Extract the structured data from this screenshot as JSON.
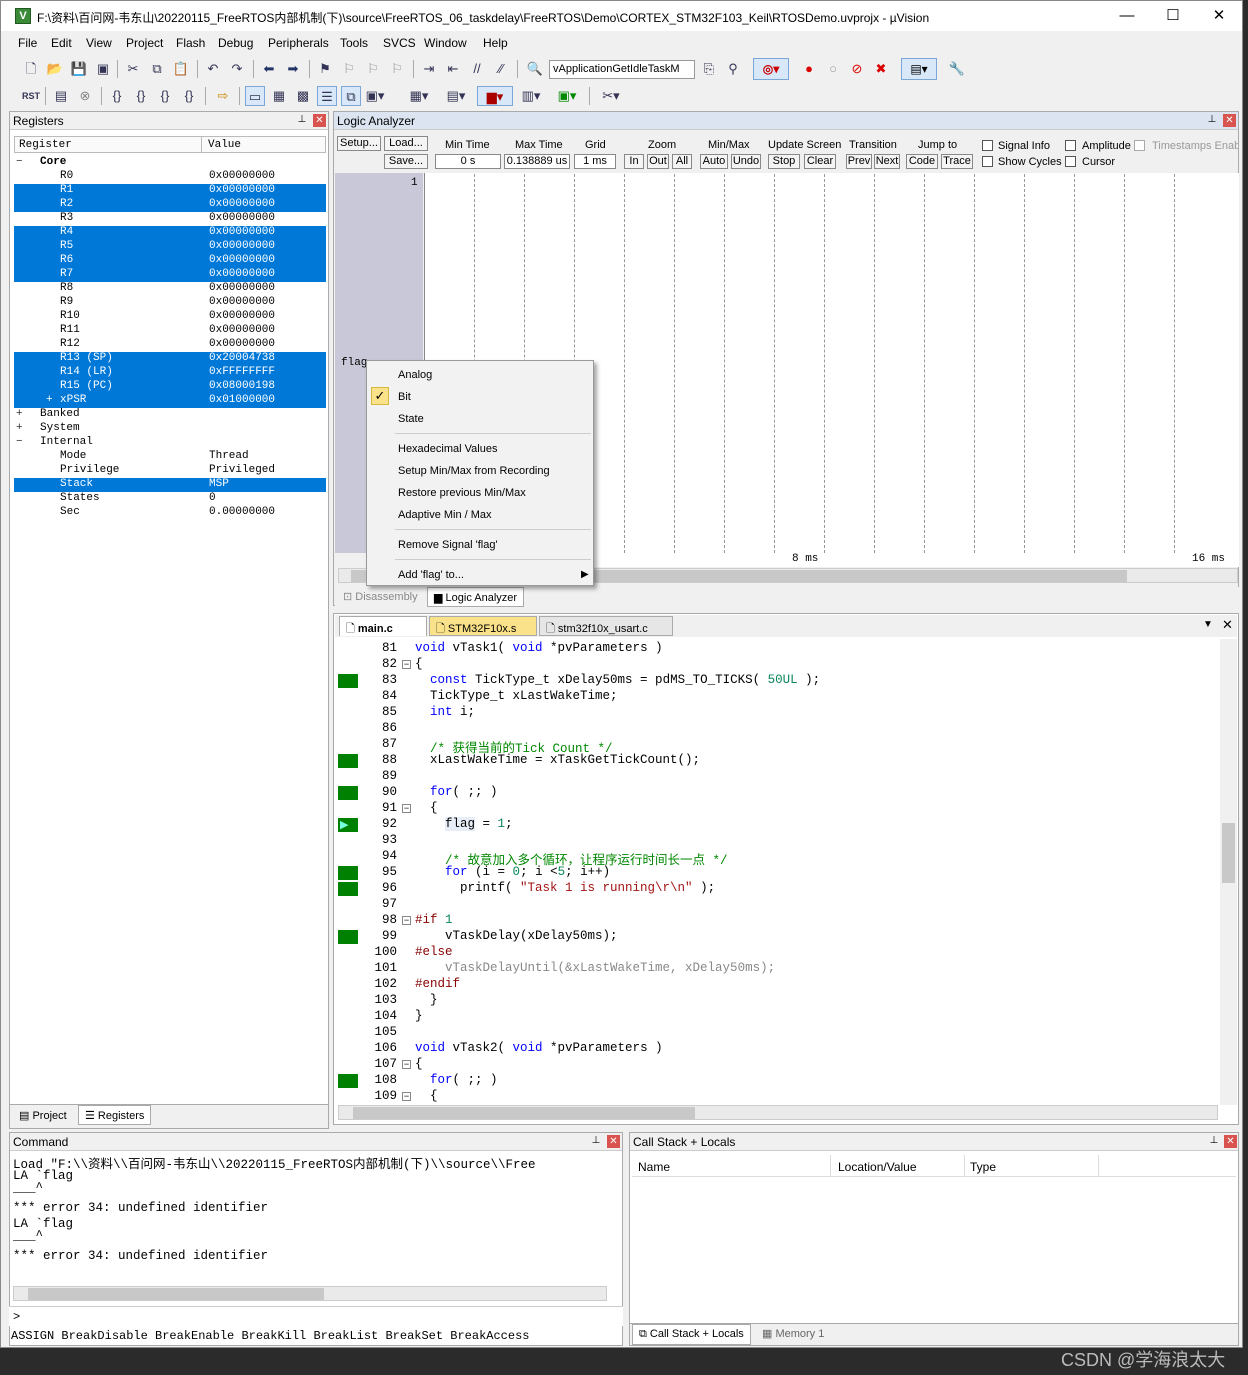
{
  "window": {
    "title": "F:\\资料\\百问网-韦东山\\20220115_FreeRTOS内部机制(下)\\source\\FreeRTOS_06_taskdelay\\FreeRTOS\\Demo\\CORTEX_STM32F103_Keil\\RTOSDemo.uvprojx - µVision",
    "minimize": "—",
    "maximize": "☐",
    "close": "✕"
  },
  "menu": [
    "File",
    "Edit",
    "View",
    "Project",
    "Flash",
    "Debug",
    "Peripherals",
    "Tools",
    "SVCS",
    "Window",
    "Help"
  ],
  "toolbar": {
    "function_combo": "vApplicationGetIdleTaskM"
  },
  "registers": {
    "title": "Registers",
    "col_register": "Register",
    "col_value": "Value",
    "rows": [
      {
        "name": "Core",
        "value": "",
        "level": 0,
        "expander": "−",
        "selected": false,
        "bold": true
      },
      {
        "name": "R0",
        "value": "0x00000000",
        "level": 2,
        "expander": "",
        "selected": false
      },
      {
        "name": "R1",
        "value": "0x00000000",
        "level": 2,
        "expander": "",
        "selected": true
      },
      {
        "name": "R2",
        "value": "0x00000000",
        "level": 2,
        "expander": "",
        "selected": true
      },
      {
        "name": "R3",
        "value": "0x00000000",
        "level": 2,
        "expander": "",
        "selected": false
      },
      {
        "name": "R4",
        "value": "0x00000000",
        "level": 2,
        "expander": "",
        "selected": true
      },
      {
        "name": "R5",
        "value": "0x00000000",
        "level": 2,
        "expander": "",
        "selected": true
      },
      {
        "name": "R6",
        "value": "0x00000000",
        "level": 2,
        "expander": "",
        "selected": true
      },
      {
        "name": "R7",
        "value": "0x00000000",
        "level": 2,
        "expander": "",
        "selected": true
      },
      {
        "name": "R8",
        "value": "0x00000000",
        "level": 2,
        "expander": "",
        "selected": false
      },
      {
        "name": "R9",
        "value": "0x00000000",
        "level": 2,
        "expander": "",
        "selected": false
      },
      {
        "name": "R10",
        "value": "0x00000000",
        "level": 2,
        "expander": "",
        "selected": false
      },
      {
        "name": "R11",
        "value": "0x00000000",
        "level": 2,
        "expander": "",
        "selected": false
      },
      {
        "name": "R12",
        "value": "0x00000000",
        "level": 2,
        "expander": "",
        "selected": false
      },
      {
        "name": "R13 (SP)",
        "value": "0x20004738",
        "level": 2,
        "expander": "",
        "selected": true
      },
      {
        "name": "R14 (LR)",
        "value": "0xFFFFFFFF",
        "level": 2,
        "expander": "",
        "selected": true
      },
      {
        "name": "R15 (PC)",
        "value": "0x08000198",
        "level": 2,
        "expander": "",
        "selected": true
      },
      {
        "name": "xPSR",
        "value": "0x01000000",
        "level": 2,
        "expander": "+",
        "selected": true
      },
      {
        "name": "Banked",
        "value": "",
        "level": 0,
        "expander": "+",
        "selected": false
      },
      {
        "name": "System",
        "value": "",
        "level": 0,
        "expander": "+",
        "selected": false
      },
      {
        "name": "Internal",
        "value": "",
        "level": 0,
        "expander": "−",
        "selected": false
      },
      {
        "name": "Mode",
        "value": "Thread",
        "level": 2,
        "expander": "",
        "selected": false
      },
      {
        "name": "Privilege",
        "value": "Privileged",
        "level": 2,
        "expander": "",
        "selected": false
      },
      {
        "name": "Stack",
        "value": "MSP",
        "level": 2,
        "expander": "",
        "selected": true
      },
      {
        "name": "States",
        "value": "0",
        "level": 2,
        "expander": "",
        "selected": false
      },
      {
        "name": "Sec",
        "value": "0.00000000",
        "level": 2,
        "expander": "",
        "selected": false
      }
    ],
    "tab_project": "Project",
    "tab_registers": "Registers"
  },
  "logic": {
    "title": "Logic Analyzer",
    "setup": "Setup...",
    "load": "Load...",
    "save": "Save...",
    "min_time_label": "Min Time",
    "min_time": "0 s",
    "max_time_label": "Max Time",
    "max_time": "0.138889 us",
    "grid_label": "Grid",
    "grid": "1 ms",
    "zoom_label": "Zoom",
    "zoom_in": "In",
    "zoom_out": "Out",
    "zoom_all": "All",
    "minmax_label": "Min/Max",
    "auto": "Auto",
    "undo": "Undo",
    "update_label": "Update Screen",
    "stop": "Stop",
    "clear": "Clear",
    "transition_label": "Transition",
    "prev": "Prev",
    "next": "Next",
    "jump_label": "Jump to",
    "code": "Code",
    "trace": "Trace",
    "signal_info": "Signal Info",
    "show_cycles": "Show Cycles",
    "amplitude": "Amplitude",
    "cursor": "Cursor",
    "timestamps": "Timestamps Enabl",
    "y_value": "1",
    "signal_name": "flag",
    "time_mid": "8 ms",
    "time_end": "16 ms",
    "tab_disassembly": "Disassembly",
    "tab_logic": "Logic Analyzer"
  },
  "context_menu": {
    "items": [
      "Analog",
      "Bit",
      "State",
      "Hexadecimal Values",
      "Setup Min/Max from Recording",
      "Restore previous Min/Max",
      "Adaptive Min / Max",
      "Remove Signal 'flag'",
      "Add 'flag' to..."
    ],
    "checked": "Bit"
  },
  "editor": {
    "tabs": [
      "main.c",
      "STM32F10x.s",
      "stm32f10x_usart.c"
    ],
    "active_tab": "main.c",
    "line_numbers": [
      "81",
      "82",
      "83",
      "84",
      "85",
      "86",
      "87",
      "88",
      "89",
      "90",
      "91",
      "92",
      "93",
      "94",
      "95",
      "96",
      "97",
      "98",
      "99",
      "100",
      "101",
      "102",
      "103",
      "104",
      "105",
      "106",
      "107",
      "108",
      "109"
    ]
  },
  "command": {
    "title": "Command",
    "lines": [
      "Load \"F:\\\\资料\\\\百问网-韦东山\\\\20220115_FreeRTOS内部机制(下)\\\\source\\\\Free",
      "LA `flag",
      "___^",
      "*** error 34: undefined identifier",
      "LA `flag",
      "___^",
      "*** error 34: undefined identifier"
    ],
    "prompt": ">",
    "hint": "ASSIGN BreakDisable BreakEnable BreakKill BreakList BreakSet BreakAccess"
  },
  "callstack": {
    "title": "Call Stack + Locals",
    "col_name": "Name",
    "col_location": "Location/Value",
    "col_type": "Type",
    "tab_callstack": "Call Stack + Locals",
    "tab_memory": "Memory 1"
  },
  "watermark": "CSDN @学海浪太大",
  "colors": {
    "selection": "#0078d7",
    "breakpoint_green": "#008000",
    "keyword": "#0000ff",
    "comment": "#008000"
  }
}
